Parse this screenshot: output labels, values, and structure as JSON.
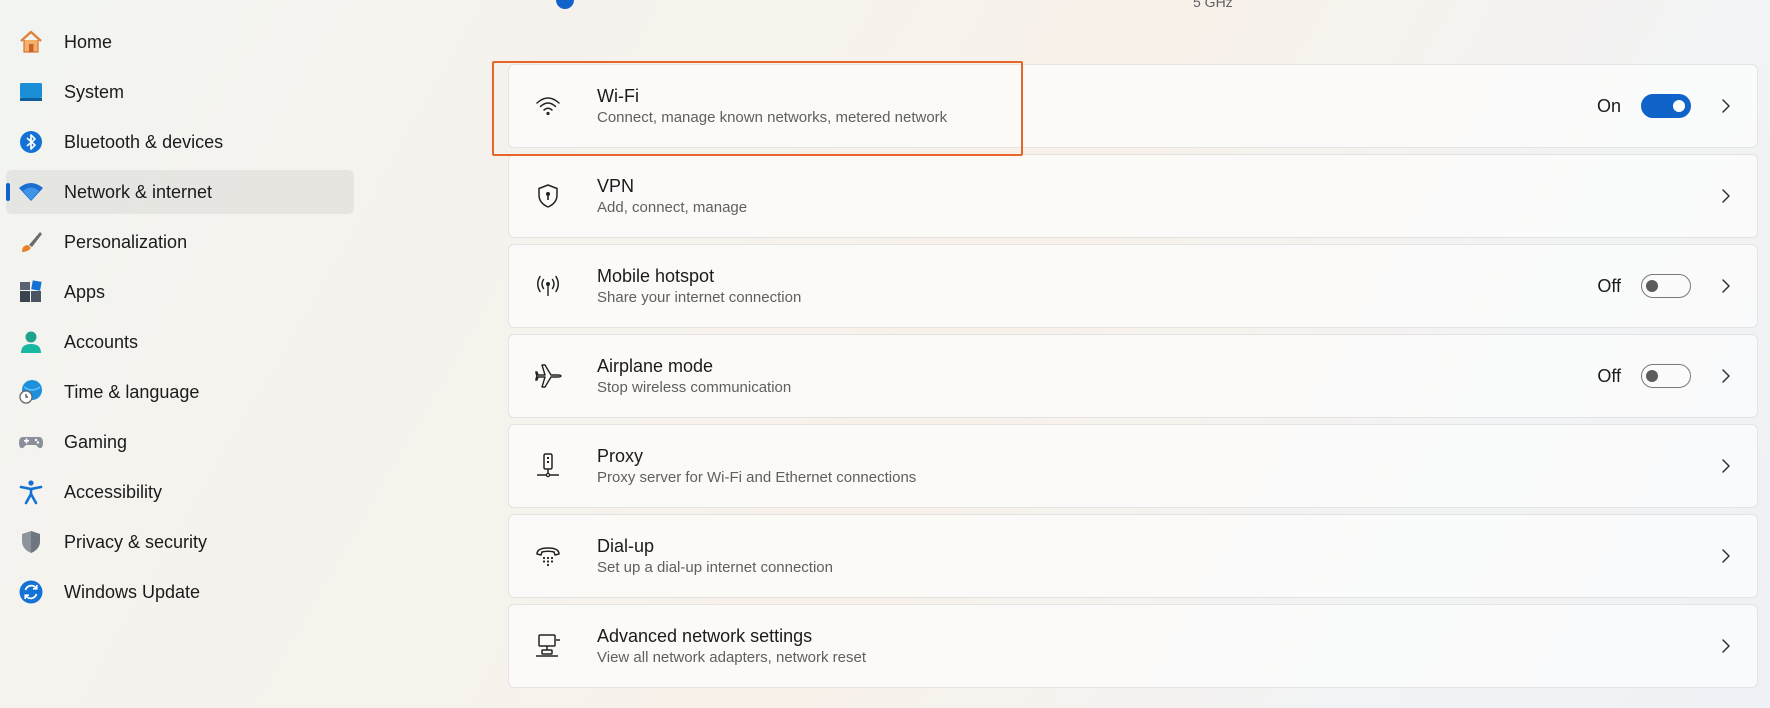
{
  "sidebar": {
    "items": [
      {
        "label": "Home",
        "icon": "home-icon"
      },
      {
        "label": "System",
        "icon": "system-icon"
      },
      {
        "label": "Bluetooth & devices",
        "icon": "bluetooth-icon"
      },
      {
        "label": "Network & internet",
        "icon": "wifi-icon",
        "selected": true
      },
      {
        "label": "Personalization",
        "icon": "brush-icon"
      },
      {
        "label": "Apps",
        "icon": "apps-icon"
      },
      {
        "label": "Accounts",
        "icon": "person-icon"
      },
      {
        "label": "Time & language",
        "icon": "globe-clock-icon"
      },
      {
        "label": "Gaming",
        "icon": "gamepad-icon"
      },
      {
        "label": "Accessibility",
        "icon": "accessibility-icon"
      },
      {
        "label": "Privacy & security",
        "icon": "shield-icon"
      },
      {
        "label": "Windows Update",
        "icon": "update-icon"
      }
    ]
  },
  "top_fragment": {
    "frequency": "5 GHz"
  },
  "cards": [
    {
      "title": "Wi-Fi",
      "desc": "Connect, manage known networks, metered network",
      "icon": "wifi-icon",
      "toggle_state": "On"
    },
    {
      "title": "VPN",
      "desc": "Add, connect, manage",
      "icon": "vpn-shield-icon"
    },
    {
      "title": "Mobile hotspot",
      "desc": "Share your internet connection",
      "icon": "hotspot-icon",
      "toggle_state": "Off"
    },
    {
      "title": "Airplane mode",
      "desc": "Stop wireless communication",
      "icon": "airplane-icon",
      "toggle_state": "Off"
    },
    {
      "title": "Proxy",
      "desc": "Proxy server for Wi-Fi and Ethernet connections",
      "icon": "proxy-icon"
    },
    {
      "title": "Dial-up",
      "desc": "Set up a dial-up internet connection",
      "icon": "dialup-icon"
    },
    {
      "title": "Advanced network settings",
      "desc": "View all network adapters, network reset",
      "icon": "network-adapter-icon"
    }
  ],
  "colors": {
    "accent": "#1064c9",
    "highlight": "#e8662b"
  }
}
